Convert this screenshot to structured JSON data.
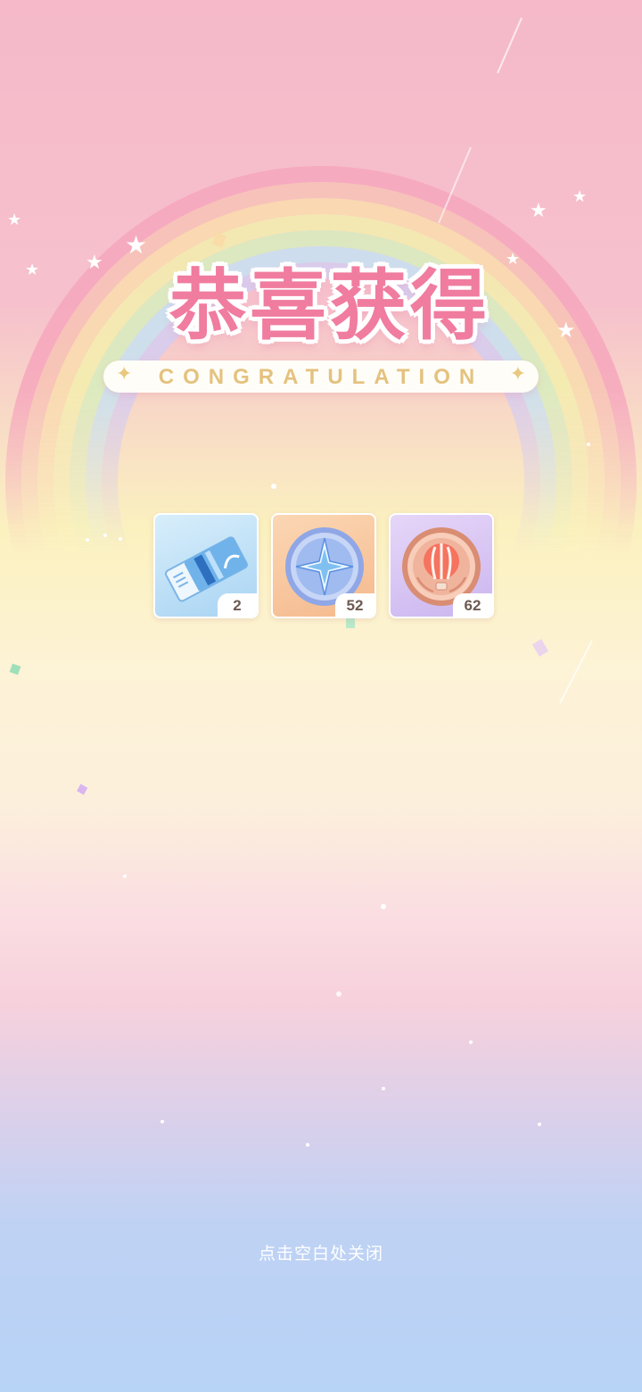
{
  "title": {
    "chinese": "恭喜获得",
    "english": "CONGRATULATION"
  },
  "rewards": [
    {
      "icon": "ticket-icon",
      "quantity": "2",
      "bg": "#bcdff6"
    },
    {
      "icon": "compass-coin-icon",
      "quantity": "52",
      "bg": "#f8c9a2"
    },
    {
      "icon": "balloon-coin-icon",
      "quantity": "62",
      "bg": "#d8c5f2"
    }
  ],
  "close_hint": "点击空白处关闭",
  "colors": {
    "title_pink": "#f07c9f",
    "banner_gold": "#e4c27e"
  }
}
